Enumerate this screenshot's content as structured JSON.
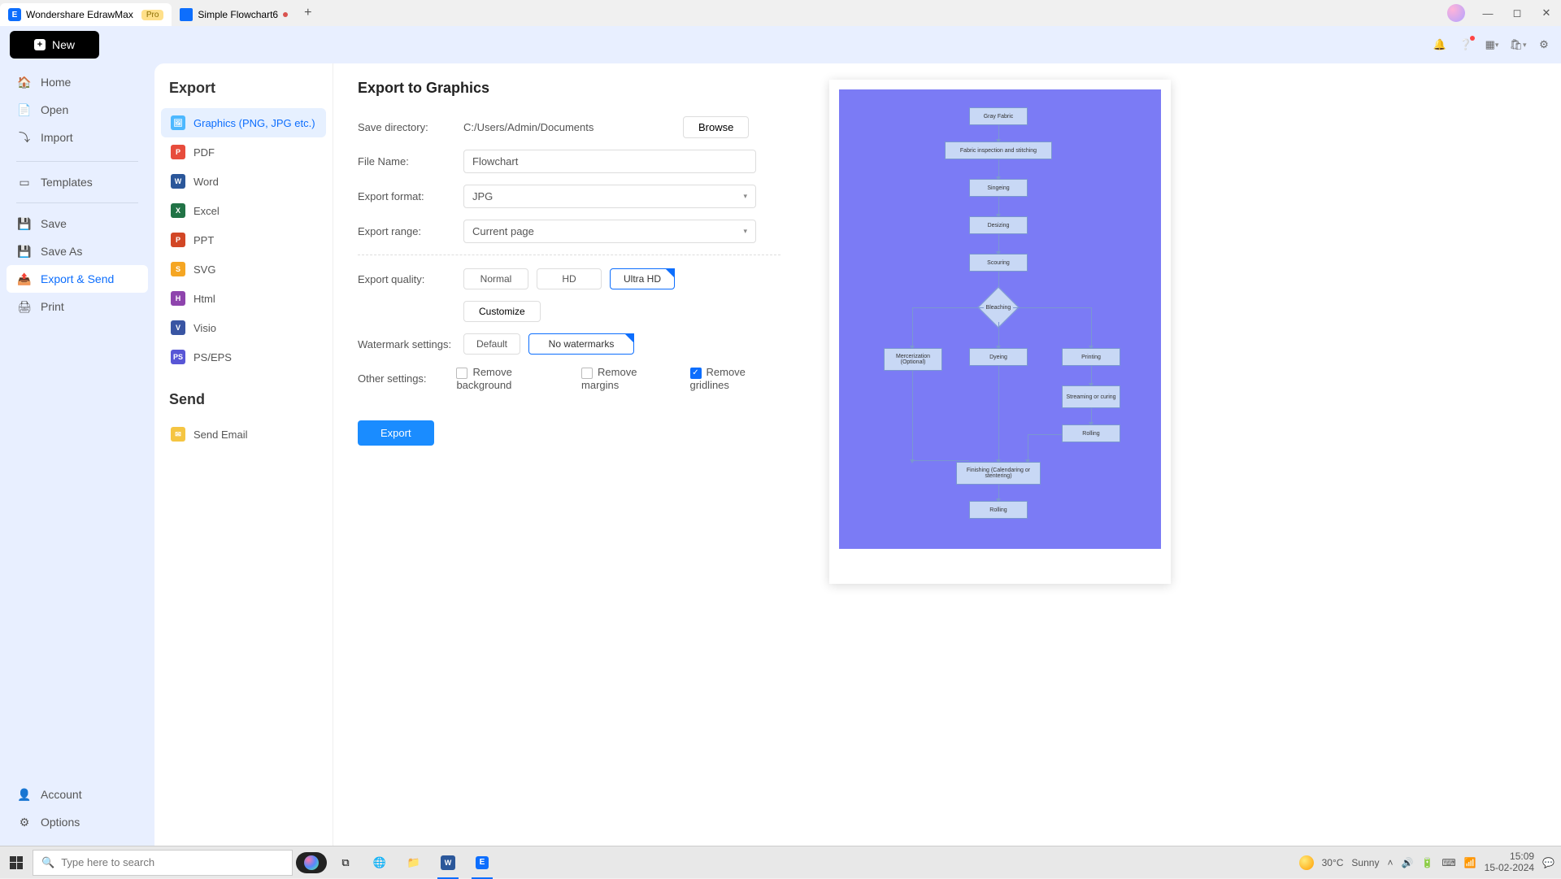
{
  "titlebar": {
    "app_name": "Wondershare EdrawMax",
    "pro_badge": "Pro",
    "second_tab": "Simple Flowchart6"
  },
  "toolbar": {
    "new_label": "New"
  },
  "leftnav": {
    "home": "Home",
    "open": "Open",
    "import": "Import",
    "templates": "Templates",
    "save": "Save",
    "save_as": "Save As",
    "export_send": "Export & Send",
    "print": "Print",
    "account": "Account",
    "options": "Options"
  },
  "export_col": {
    "title": "Export",
    "graphics": "Graphics (PNG, JPG etc.)",
    "pdf": "PDF",
    "word": "Word",
    "excel": "Excel",
    "ppt": "PPT",
    "svg": "SVG",
    "html": "Html",
    "visio": "Visio",
    "pseps": "PS/EPS",
    "send_title": "Send",
    "send_email": "Send Email"
  },
  "form": {
    "title": "Export to Graphics",
    "save_dir_label": "Save directory:",
    "save_dir_value": "C:/Users/Admin/Documents",
    "browse": "Browse",
    "filename_label": "File Name:",
    "filename_value": "Flowchart",
    "format_label": "Export format:",
    "format_value": "JPG",
    "range_label": "Export range:",
    "range_value": "Current page",
    "quality_label": "Export quality:",
    "quality_normal": "Normal",
    "quality_hd": "HD",
    "quality_uhd": "Ultra HD",
    "customize": "Customize",
    "watermark_label": "Watermark settings:",
    "watermark_default": "Default",
    "watermark_none": "No watermarks",
    "other_label": "Other settings:",
    "remove_bg": "Remove background",
    "remove_margins": "Remove margins",
    "remove_gridlines": "Remove gridlines",
    "export_btn": "Export"
  },
  "preview": {
    "n1": "Gray Fabric",
    "n2": "Fabric inspection and stitching",
    "n3": "Singeing",
    "n4": "Desizing",
    "n5": "Scouring",
    "n6": "Bleaching",
    "n7a": "Mercerization (Optional)",
    "n7b": "Dyeing",
    "n7c": "Printing",
    "n8": "Streaming or curing",
    "n9": "Rolling",
    "n10": "Finishing (Calendaring or stentering)",
    "n11": "Rolling"
  },
  "taskbar": {
    "search_placeholder": "Type here to search",
    "temp": "30°C",
    "weather": "Sunny",
    "time": "15:09",
    "date": "15-02-2024"
  }
}
